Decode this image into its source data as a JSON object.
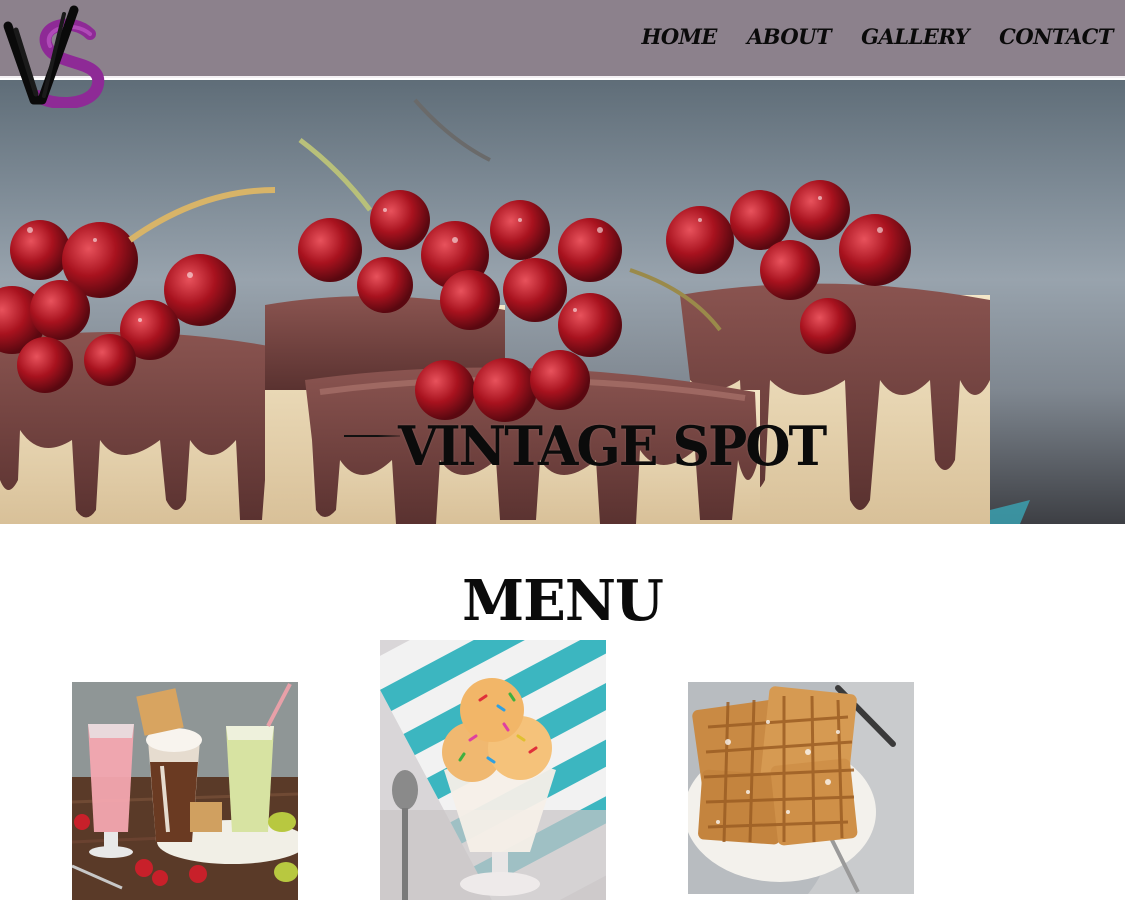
{
  "header": {
    "logo_letters": "VS",
    "nav": [
      {
        "label": "HOME"
      },
      {
        "label": "ABOUT"
      },
      {
        "label": "GALLERY"
      },
      {
        "label": "CONTACT"
      }
    ]
  },
  "hero": {
    "title": "VINTAGE SPOT"
  },
  "menu": {
    "title": "MENU",
    "items": [
      {
        "icon": "milkshake-photo"
      },
      {
        "icon": "ice-cream-sundae-photo"
      },
      {
        "icon": "waffles-photo"
      }
    ]
  },
  "colors": {
    "header_bg": "#8c818c",
    "logo_purple": "#8e2a96",
    "text": "#0b0b0b",
    "page_bg": "#ffffff"
  }
}
